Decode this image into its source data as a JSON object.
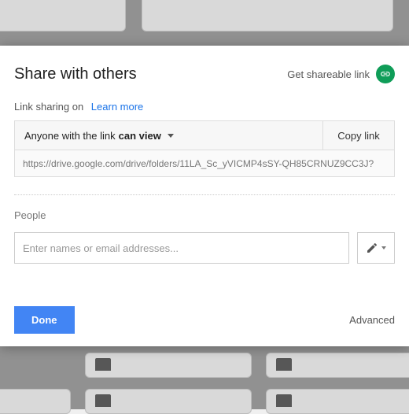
{
  "dialog": {
    "title": "Share with others",
    "shareable_label": "Get shareable link",
    "link_sharing_status": "Link sharing on",
    "learn_more": "Learn more",
    "perm_prefix": "Anyone with the link",
    "perm_level": "can view",
    "copy_link": "Copy link",
    "url": "https://drive.google.com/drive/folders/11LA_Sc_yVICMP4sSY-QH85CRNUZ9CC3J?",
    "people_label": "People",
    "people_placeholder": "Enter names or email addresses...",
    "done": "Done",
    "advanced": "Advanced"
  }
}
